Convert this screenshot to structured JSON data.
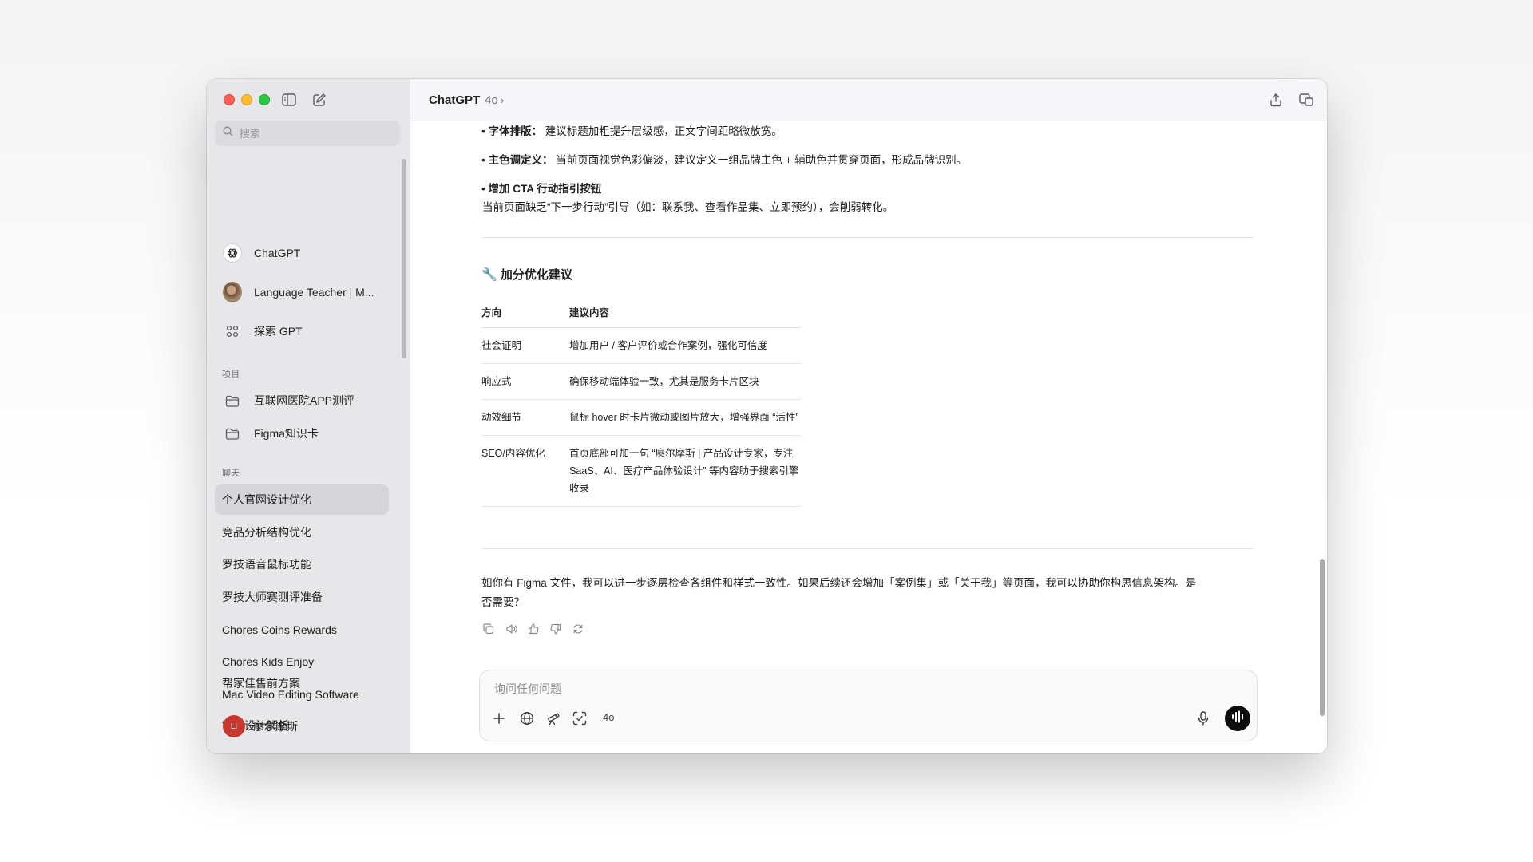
{
  "sidebar": {
    "search_placeholder": "搜索",
    "pinned": [
      {
        "label": "ChatGPT",
        "icon": "openai-logo-icon"
      },
      {
        "label": "Language Teacher | M...",
        "icon": "gpt-avatar-icon"
      },
      {
        "label": "探索 GPT",
        "icon": "grid-icon"
      }
    ],
    "projects_heading": "项目",
    "projects": [
      {
        "label": "互联网医院APP测评",
        "icon": "folder-icon"
      },
      {
        "label": "Figma知识卡",
        "icon": "folder-icon"
      }
    ],
    "chats_heading": "聊天",
    "chats": [
      {
        "label": "个人官网设计优化",
        "active": true
      },
      {
        "label": "竞品分析结构优化"
      },
      {
        "label": "罗技语音鼠标功能"
      },
      {
        "label": "罗技大师赛测评准备"
      },
      {
        "label": "Chores Coins Rewards"
      },
      {
        "label": "Chores Kids Enjoy"
      },
      {
        "label": "Mac Video Editing Software"
      },
      {
        "label": "键盘设计解析"
      },
      {
        "label": "帮家佳售前方案"
      }
    ],
    "user": {
      "initials": "LI",
      "name": "廖尔摩斯"
    }
  },
  "header": {
    "title": "ChatGPT",
    "model": "4o",
    "chevron": "›"
  },
  "message": {
    "bullets": [
      {
        "bold": "字体排版：",
        "text": "建议标题加粗提升层级感，正文字间距略微放宽。"
      },
      {
        "bold": "主色调定义：",
        "text": "当前页面视觉色彩偏淡，建议定义一组品牌主色 + 辅助色并贯穿页面，形成品牌识别。"
      },
      {
        "bold": "增加 CTA 行动指引按钮",
        "text": ""
      }
    ],
    "cta_text": "当前页面缺乏“下一步行动”引导（如：联系我、查看作品集、立即预约），会削弱转化。",
    "section_title": "加分优化建议",
    "section_icon": "🔧",
    "table": {
      "headers": [
        "方向",
        "建议内容"
      ],
      "rows": [
        [
          "社会证明",
          "增加用户 / 客户评价或合作案例，强化可信度"
        ],
        [
          "响应式",
          "确保移动端体验一致，尤其是服务卡片区块"
        ],
        [
          "动效细节",
          "鼠标 hover 时卡片微动或图片放大，增强界面 “活性”"
        ],
        [
          "SEO/内容优化",
          "首页底部可加一句 “廖尔摩斯 | 产品设计专家，专注 SaaS、AI、医疗产品体验设计” 等内容助于搜索引擎收录"
        ]
      ]
    },
    "closing": "如你有 Figma 文件，我可以进一步逐层检查各组件和样式一致性。如果后续还会增加「案例集」或「关于我」等页面，我可以协助你构思信息架构。是否需要？"
  },
  "composer": {
    "placeholder": "询问任何问题",
    "model_label": "4o"
  }
}
